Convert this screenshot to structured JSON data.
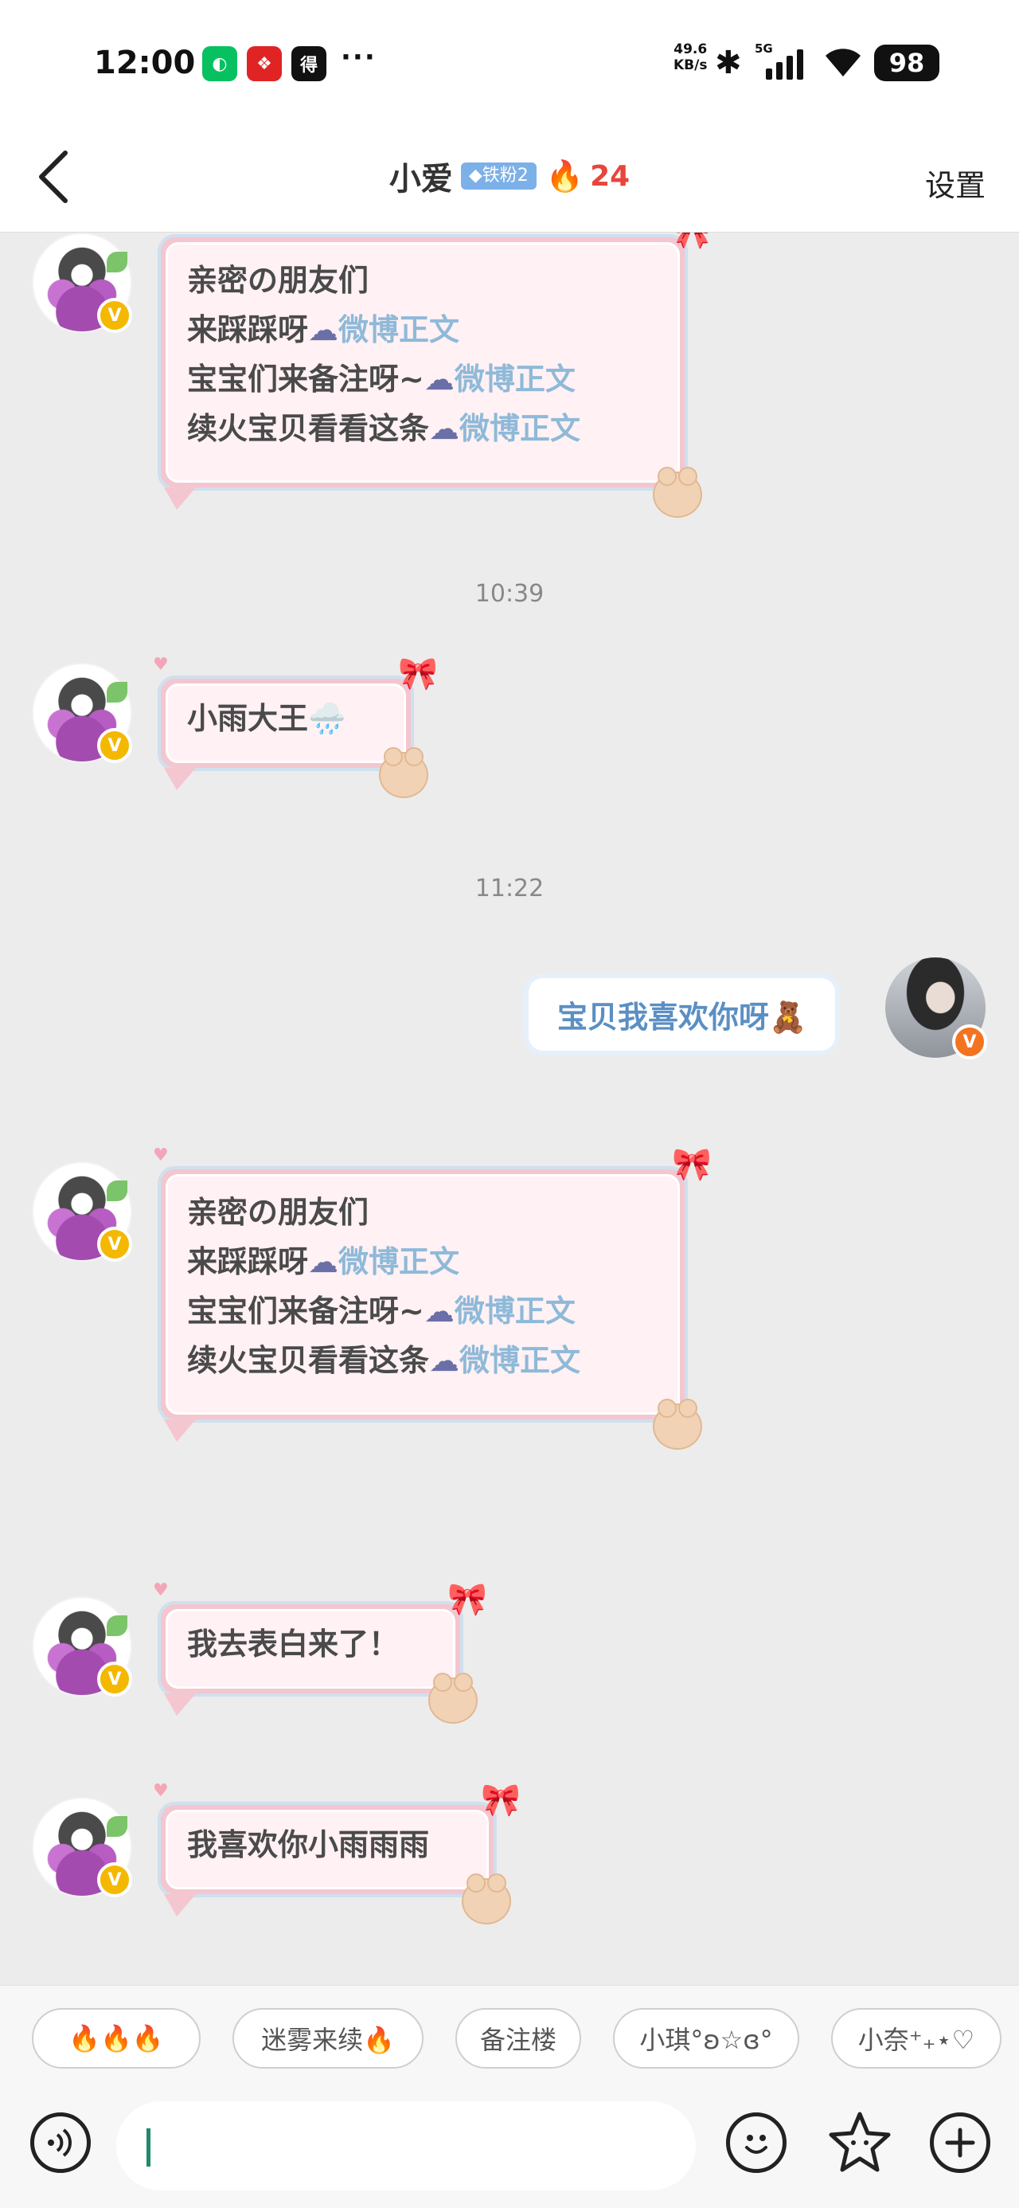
{
  "status_bar": {
    "time": "12:00",
    "app_icons": [
      {
        "name": "wechat-icon",
        "color": "#07c160",
        "glyph": "◐"
      },
      {
        "name": "red-app-icon",
        "color": "#e02424",
        "glyph": "❖"
      },
      {
        "name": "news-app-icon",
        "color": "#111111",
        "glyph": "得"
      }
    ],
    "more": "···",
    "net_speed_value": "49.6",
    "net_speed_unit": "KB/s",
    "network": "5G",
    "battery": "98"
  },
  "header": {
    "back_icon": "chevron-left-icon",
    "name": "小爱",
    "fan_badge": "◆铁粉2",
    "fire_icon": "🔥",
    "streak_count": "24",
    "settings": "设置"
  },
  "chat": {
    "messages": [
      {
        "lines": [
          [
            "亲密の朋友们",
            ""
          ],
          [
            "来踩踩呀",
            "微博正文"
          ],
          [
            "宝宝们来备注呀~",
            "微博正文"
          ],
          [
            "续火宝贝看看这条",
            "微博正文"
          ]
        ]
      },
      {
        "timestamp": "10:39"
      },
      {
        "text": "小雨大王",
        "emoji": "🌧️"
      },
      {
        "timestamp": "11:22"
      },
      {
        "me_text": "宝贝我喜欢你呀"
      },
      {
        "lines": [
          [
            "亲密の朋友们",
            ""
          ],
          [
            "来踩踩呀",
            "微博正文"
          ],
          [
            "宝宝们来备注呀~",
            "微博正文"
          ],
          [
            "续火宝贝看看这条",
            "微博正文"
          ]
        ]
      },
      {
        "text": "我去表白来了！"
      },
      {
        "text": "我喜欢你小雨雨雨"
      }
    ],
    "cloud_icon": "☁",
    "verified_badge": "V"
  },
  "quick_replies": [
    "🔥🔥🔥",
    "迷雾来续🔥",
    "备注楼",
    "小琪°ʚ☆ɞ°",
    "小奈⁺₊⋆♡"
  ],
  "input_bar": {
    "voice_icon": "voice-icon",
    "emoji_icon": "smile-icon",
    "sticker_icon": "star-icon",
    "plus_icon": "plus-icon"
  },
  "colors": {
    "bubble_pink": "#f4c6cf",
    "bubble_inner": "#fff1f4",
    "link_blue": "#8fb9d8",
    "streak_red": "#e8453c",
    "badge_blue": "#7cb0e8"
  }
}
